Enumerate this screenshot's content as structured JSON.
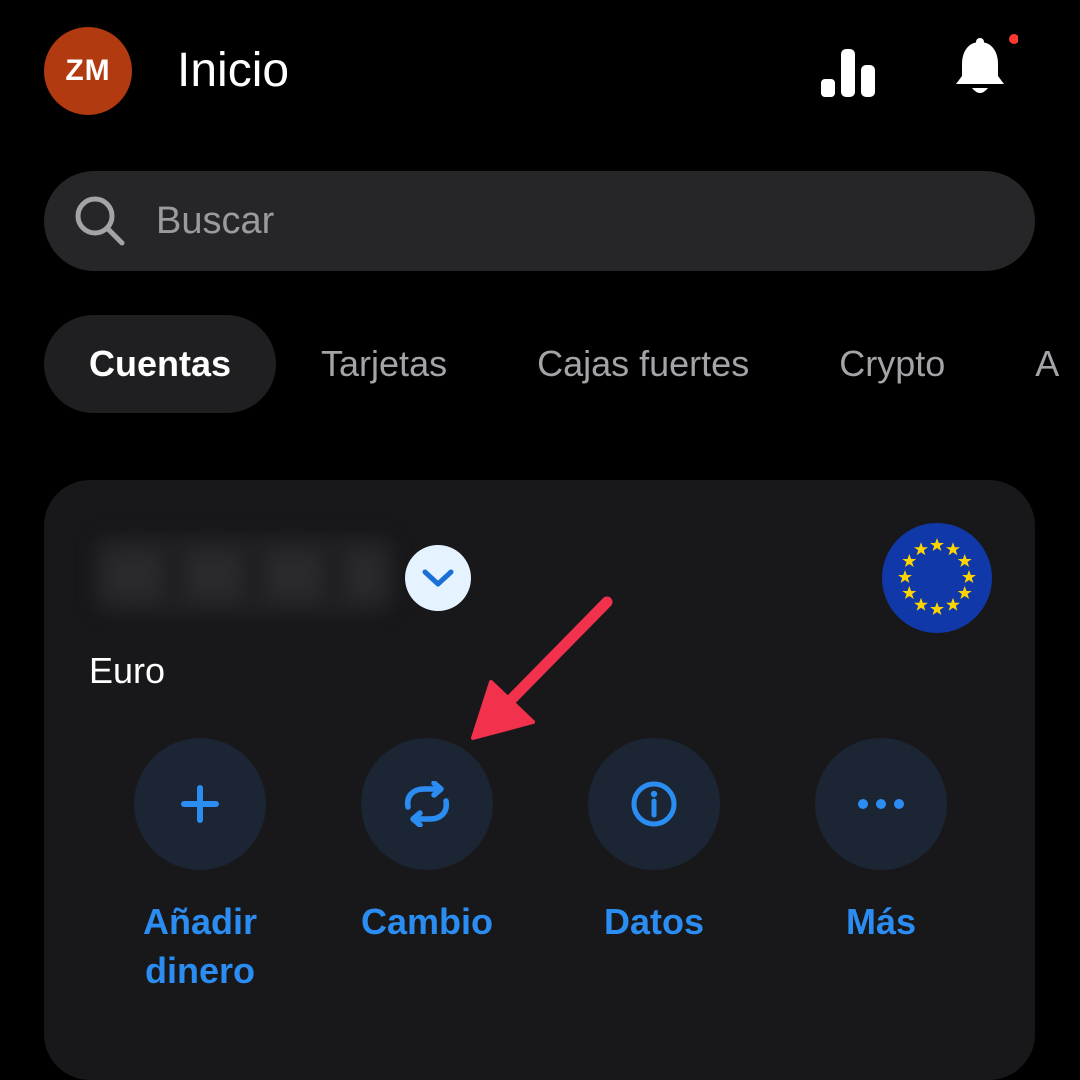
{
  "header": {
    "avatar_initials": "ZM",
    "title": "Inicio",
    "notification_dot_color": "#ff3b30"
  },
  "search": {
    "placeholder": "Buscar",
    "value": ""
  },
  "tabs": [
    {
      "label": "Cuentas",
      "active": true
    },
    {
      "label": "Tarjetas",
      "active": false
    },
    {
      "label": "Cajas fuertes",
      "active": false
    },
    {
      "label": "Crypto",
      "active": false
    },
    {
      "label": "A",
      "active": false
    }
  ],
  "account": {
    "currency": "Euro",
    "flag_icon": "eu-flag-icon",
    "balance_hidden": true
  },
  "actions": [
    {
      "label": "Añadir dinero",
      "icon": "plus-icon"
    },
    {
      "label": "Cambio",
      "icon": "exchange-icon"
    },
    {
      "label": "Datos",
      "icon": "info-icon"
    },
    {
      "label": "Más",
      "icon": "more-icon"
    }
  ],
  "colors": {
    "accent": "#2b8df2",
    "avatar": "#b23a10",
    "annotation_arrow": "#f2324c",
    "eu_blue": "#1038a8",
    "eu_gold": "#ffd400"
  }
}
